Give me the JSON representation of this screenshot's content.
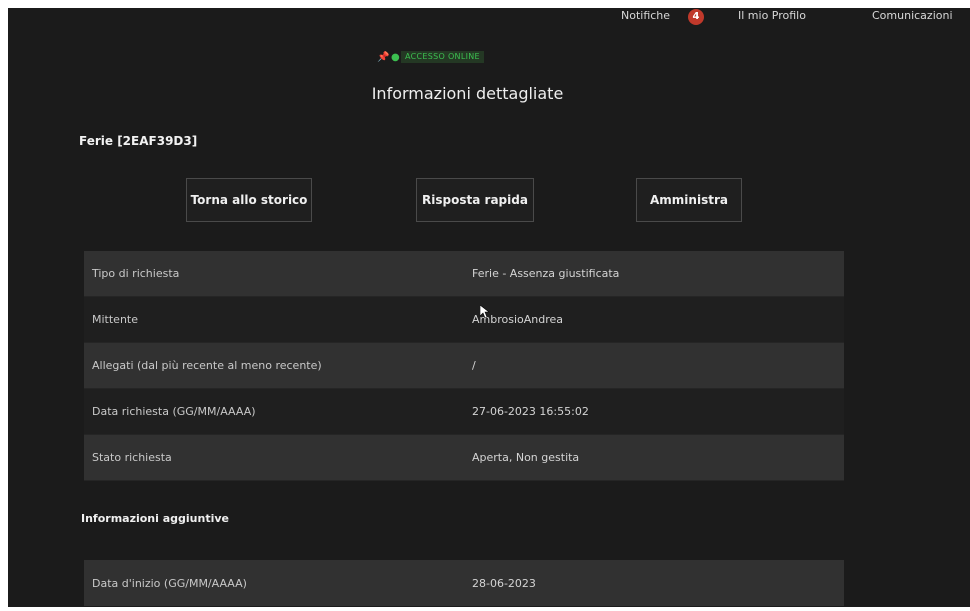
{
  "topnav": {
    "notifications_label": "Notifiche",
    "notifications_count": "4",
    "profile_label": "Il mio Profilo",
    "communications_label": "Comunicazioni"
  },
  "status": {
    "text": "ACCESSO ONLINE",
    "color": "#3cbf50"
  },
  "page": {
    "title": "Informazioni dettagliate",
    "request_id": "Ferie [2EAF39D3]"
  },
  "actions": {
    "back": "Torna allo storico",
    "quick_reply": "Risposta rapida",
    "manage": "Amministra"
  },
  "details": [
    {
      "label": "Tipo di richiesta",
      "value": "Ferie - Assenza giustificata"
    },
    {
      "label": "Mittente",
      "value": "AmbrosioAndrea"
    },
    {
      "label": "Allegati (dal più recente al meno recente)",
      "value": "/"
    },
    {
      "label": "Data richiesta (GG/MM/AAAA)",
      "value": "27-06-2023 16:55:02"
    },
    {
      "label": "Stato richiesta",
      "value": "Aperta, Non gestita"
    }
  ],
  "extra": {
    "title": "Informazioni aggiuntive",
    "rows": [
      {
        "label": "Data d'inizio (GG/MM/AAAA)",
        "value": "28-06-2023"
      }
    ]
  },
  "colors": {
    "background": "#1b1b1b",
    "row_alt": "#313131",
    "badge": "#c0392b"
  }
}
